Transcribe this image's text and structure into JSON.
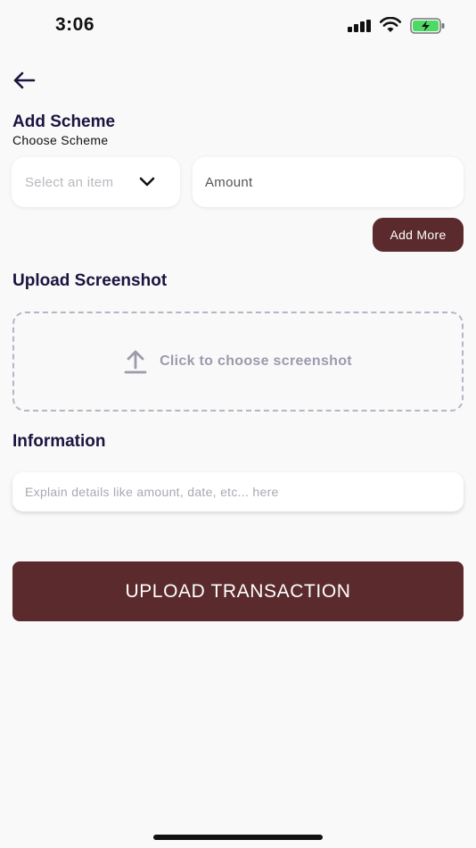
{
  "status_bar": {
    "time": "3:06",
    "icons": [
      "signal-icon",
      "wifi-icon",
      "battery-charging-icon"
    ]
  },
  "nav": {
    "back_icon": "arrow-left-icon"
  },
  "scheme": {
    "title": "Add Scheme",
    "subtitle": "Choose Scheme",
    "select_placeholder": "Select an item",
    "amount_placeholder": "Amount",
    "add_more_label": "Add More"
  },
  "screenshot": {
    "title": "Upload Screenshot",
    "dropzone_label": "Click to choose screenshot",
    "icon": "upload-icon"
  },
  "information": {
    "title": "Information",
    "placeholder": "Explain details like amount, date, etc... here"
  },
  "submit": {
    "label": "UPLOAD TRANSACTION"
  },
  "colors": {
    "accent": "#5a2a2c",
    "heading": "#1a1440",
    "background": "#f9f9f9"
  }
}
